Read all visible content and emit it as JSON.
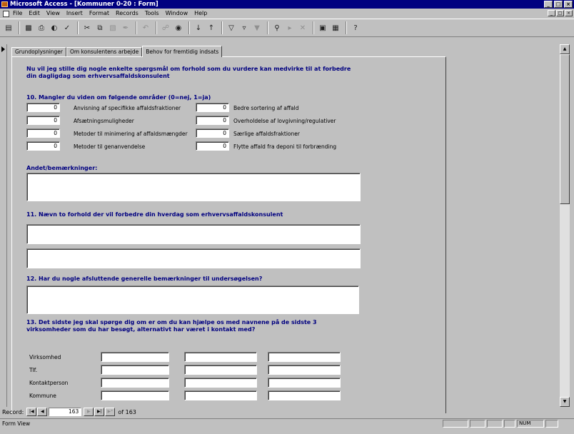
{
  "window": {
    "title": "Microsoft Access - [Kommuner 0-20 : Form]",
    "buttons": [
      "_",
      "□",
      "×"
    ]
  },
  "menu": [
    "File",
    "Edit",
    "View",
    "Insert",
    "Format",
    "Records",
    "Tools",
    "Window",
    "Help"
  ],
  "tabs": [
    "Grundoplysninger",
    "Om konsulentens arbejde",
    "Behov for fremtidig indsats"
  ],
  "intro": "Nu vil jeg stille dig nogle enkelte spørgsmål om forhold som du vurdere kan medvirke til at forbedre din dagligdag som erhvervsaffaldskonsulent",
  "q10": {
    "title": "10. Mangler du viden om følgende områder (0=nej, 1=ja)",
    "items_left": [
      {
        "value": "0",
        "label": "Anvisning af specifikke affaldsfraktioner"
      },
      {
        "value": "0",
        "label": "Afsætningsmuligheder"
      },
      {
        "value": "0",
        "label": "Metoder til minimering af affaldsmængder"
      },
      {
        "value": "0",
        "label": "Metoder til genanvendelse"
      }
    ],
    "items_right": [
      {
        "value": "0",
        "label": "Bedre sortering af affald"
      },
      {
        "value": "0",
        "label": "Overholdelse af lovgivning/regulativer"
      },
      {
        "value": "0",
        "label": "Særlige affaldsfraktioner"
      },
      {
        "value": "0",
        "label": "Flytte affald fra deponi til forbrænding"
      }
    ]
  },
  "andet_label": "Andet/bemærkninger:",
  "q11": "11. Nævn to forhold der vil forbedre din hverdag som erhvervsaffaldskonsulent",
  "q12": "12. Har du nogle afsluttende generelle bemærkninger til undersøgelsen?",
  "q13": "13. Det sidste jeg skal spørge dig om er om du kan hjælpe os med navnene på de sidste 3 virksomheder som du har besøgt, alternativt har været i kontakt med?",
  "company_rows": [
    "Virksomhed",
    "Tlf.",
    "Kontaktperson",
    "Kommune"
  ],
  "navigation": {
    "label": "Record:",
    "current": "163",
    "of_text": "of 163",
    "first": "|◀",
    "prev": "◀",
    "next": "▶",
    "last": "▶|",
    "new": "▶*"
  },
  "status": {
    "text": "Form View",
    "num": "NUM"
  },
  "toolbar_icons": [
    "view-icon",
    "save-icon",
    "print-icon",
    "print-preview-icon",
    "spelling-icon",
    "cut-icon",
    "copy-icon",
    "paste-icon",
    "format-painter-icon",
    "undo-icon",
    "insert-hyperlink-icon",
    "web-toolbar-icon",
    "sort-ascending-icon",
    "sort-descending-icon",
    "filter-by-selection-icon",
    "filter-by-form-icon",
    "apply-filter-icon",
    "find-icon",
    "new-record-icon",
    "delete-record-icon",
    "database-window-icon",
    "new-object-icon",
    "help-icon"
  ]
}
